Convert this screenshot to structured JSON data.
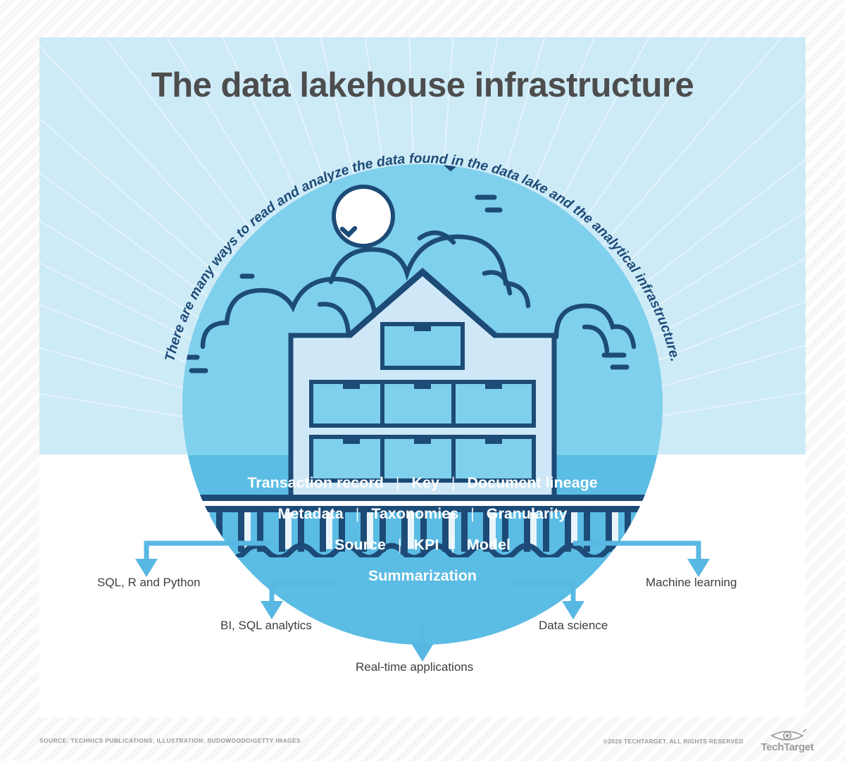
{
  "page": {
    "title": "The data lakehouse infrastructure",
    "subtitle": "There are many ways to read and analyze the data found in the data lake and the analytical infrastructure."
  },
  "colors": {
    "panel_light_blue": "#cdeaf7",
    "circle_sky": "#7fd0ec",
    "circle_water": "#5bbce4",
    "outline_navy": "#1d4b77",
    "arrow_blue": "#58b8e3",
    "title_gray": "#4d4d4d",
    "label_gray": "#3d3d3d",
    "footer_gray": "#9a9a9a",
    "house_body": "#cfe8f7",
    "white": "#ffffff"
  },
  "illustration": {
    "name": "lakehouse-on-stilts",
    "elements": [
      "sun",
      "clouds",
      "birds",
      "house",
      "dock",
      "pilings",
      "water"
    ]
  },
  "keywords": {
    "separator": "|",
    "rows": [
      [
        "Transaction record",
        "Key",
        "Document lineage"
      ],
      [
        "Metadata",
        "Taxonomies",
        "Granularity"
      ],
      [
        "Source",
        "KPI",
        "Model"
      ],
      [
        "Summarization"
      ]
    ]
  },
  "outcomes": [
    {
      "id": "sql-r-python",
      "label": "SQL, R and Python"
    },
    {
      "id": "bi-sql-analytics",
      "label": "BI, SQL analytics"
    },
    {
      "id": "real-time-apps",
      "label": "Real-time applications"
    },
    {
      "id": "data-science",
      "label": "Data science"
    },
    {
      "id": "machine-learning",
      "label": "Machine learning"
    }
  ],
  "footer": {
    "source": "SOURCE: TECHNICS PUBLICATIONS; ILLUSTRATION: SUDOWOODO/GETTY IMAGES",
    "rights": "©2020 TECHTARGET. ALL RIGHTS RESERVED",
    "brand": "TechTarget"
  }
}
